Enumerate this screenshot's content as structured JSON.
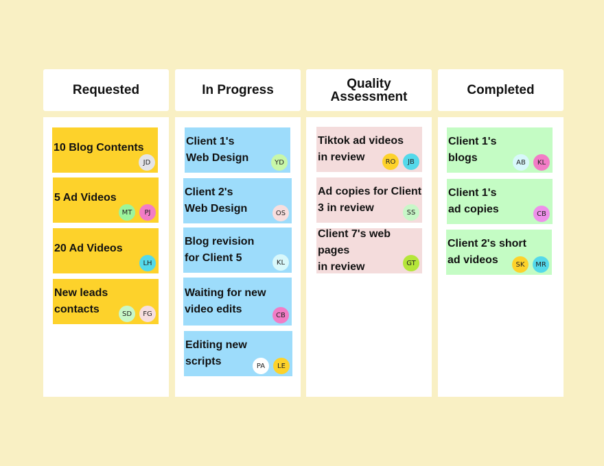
{
  "colors": {
    "background": "#f9f0c4",
    "requested": "#fdd22b",
    "in_progress": "#9ddcfb",
    "quality_assessment": "#f4dcdc",
    "completed": "#c4fcc4"
  },
  "columns": [
    {
      "title": "Requested",
      "cards": [
        {
          "title": "10 Blog Contents",
          "assignees": [
            {
              "initials": "JD",
              "color": "#e4e4e8"
            }
          ]
        },
        {
          "title": "5 Ad Videos",
          "assignees": [
            {
              "initials": "MT",
              "color": "#9cf59c"
            },
            {
              "initials": "PJ",
              "color": "#f27cc6"
            }
          ]
        },
        {
          "title": "20 Ad Videos",
          "assignees": [
            {
              "initials": "LH",
              "color": "#54d9ea"
            }
          ]
        },
        {
          "title": "New leads\ncontacts",
          "assignees": [
            {
              "initials": "SD",
              "color": "#c8f7c8"
            },
            {
              "initials": "FG",
              "color": "#f7dedf"
            }
          ]
        }
      ]
    },
    {
      "title": "In Progress",
      "cards": [
        {
          "title": "Client 1's\nWeb Design",
          "assignees": [
            {
              "initials": "YD",
              "color": "#c8f7a8"
            }
          ]
        },
        {
          "title": "Client 2's\nWeb Design",
          "assignees": [
            {
              "initials": "OS",
              "color": "#f8dede"
            }
          ]
        },
        {
          "title": "Blog revision\nfor Client 5",
          "assignees": [
            {
              "initials": "KL",
              "color": "#d8f8fb"
            }
          ]
        },
        {
          "title": "Waiting for new\nvideo edits",
          "assignees": [
            {
              "initials": "CB",
              "color": "#f27cc6"
            }
          ]
        },
        {
          "title": "Editing new\nscripts",
          "assignees": [
            {
              "initials": "PA",
              "color": "#ffffff"
            },
            {
              "initials": "LE",
              "color": "#fdd22b"
            }
          ]
        }
      ]
    },
    {
      "title": "Quality\nAssessment",
      "cards": [
        {
          "title": "Tiktok ad videos\nin review",
          "assignees": [
            {
              "initials": "RO",
              "color": "#fdd22b"
            },
            {
              "initials": "JB",
              "color": "#54d9ea"
            }
          ]
        },
        {
          "title": "Ad copies for Client\n3 in review",
          "assignees": [
            {
              "initials": "SS",
              "color": "#c8f7c8"
            }
          ]
        },
        {
          "title": "Client 7's web pages\nin review",
          "assignees": [
            {
              "initials": "GT",
              "color": "#b5e63a"
            }
          ]
        }
      ]
    },
    {
      "title": "Completed",
      "cards": [
        {
          "title": "Client 1's\nblogs",
          "assignees": [
            {
              "initials": "AB",
              "color": "#d8f8fb"
            },
            {
              "initials": "KL",
              "color": "#f27cc6"
            }
          ]
        },
        {
          "title": "Client 1's\nad copies",
          "assignees": [
            {
              "initials": "CB",
              "color": "#ee90ea"
            }
          ]
        },
        {
          "title": "Client 2's short\nad videos",
          "assignees": [
            {
              "initials": "SK",
              "color": "#fdd22b"
            },
            {
              "initials": "MR",
              "color": "#54d9ea"
            }
          ]
        }
      ]
    }
  ]
}
